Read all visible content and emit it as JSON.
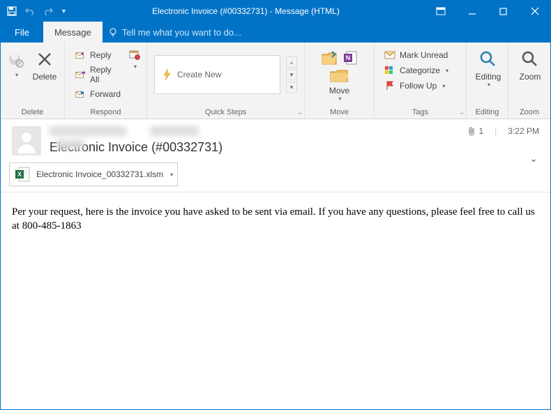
{
  "window": {
    "title": "Electronic Invoice (#00332731) - Message (HTML)"
  },
  "menu": {
    "file": "File",
    "message": "Message",
    "tellme": "Tell me what you want to do..."
  },
  "ribbon": {
    "delete_group": "Delete",
    "delete": "Delete",
    "respond_group": "Respond",
    "reply": "Reply",
    "reply_all": "Reply All",
    "forward": "Forward",
    "quicksteps_group": "Quick Steps",
    "create_new": "Create New",
    "move_group": "Move",
    "move": "Move",
    "tags_group": "Tags",
    "mark_unread": "Mark Unread",
    "categorize": "Categorize",
    "follow_up": "Follow Up",
    "editing_group": "Editing",
    "editing": "Editing",
    "zoom_group": "Zoom",
    "zoom": "Zoom"
  },
  "message": {
    "subject": "Electronic Invoice (#00332731)",
    "attachment_count": "1",
    "time": "3:22 PM",
    "attachment_name": "Electronic Invoice_00332731.xlsm",
    "body": "Per your request, here is the invoice you have asked to be sent via email. If you have any questions, please feel free to call us at 800-485-1863"
  }
}
